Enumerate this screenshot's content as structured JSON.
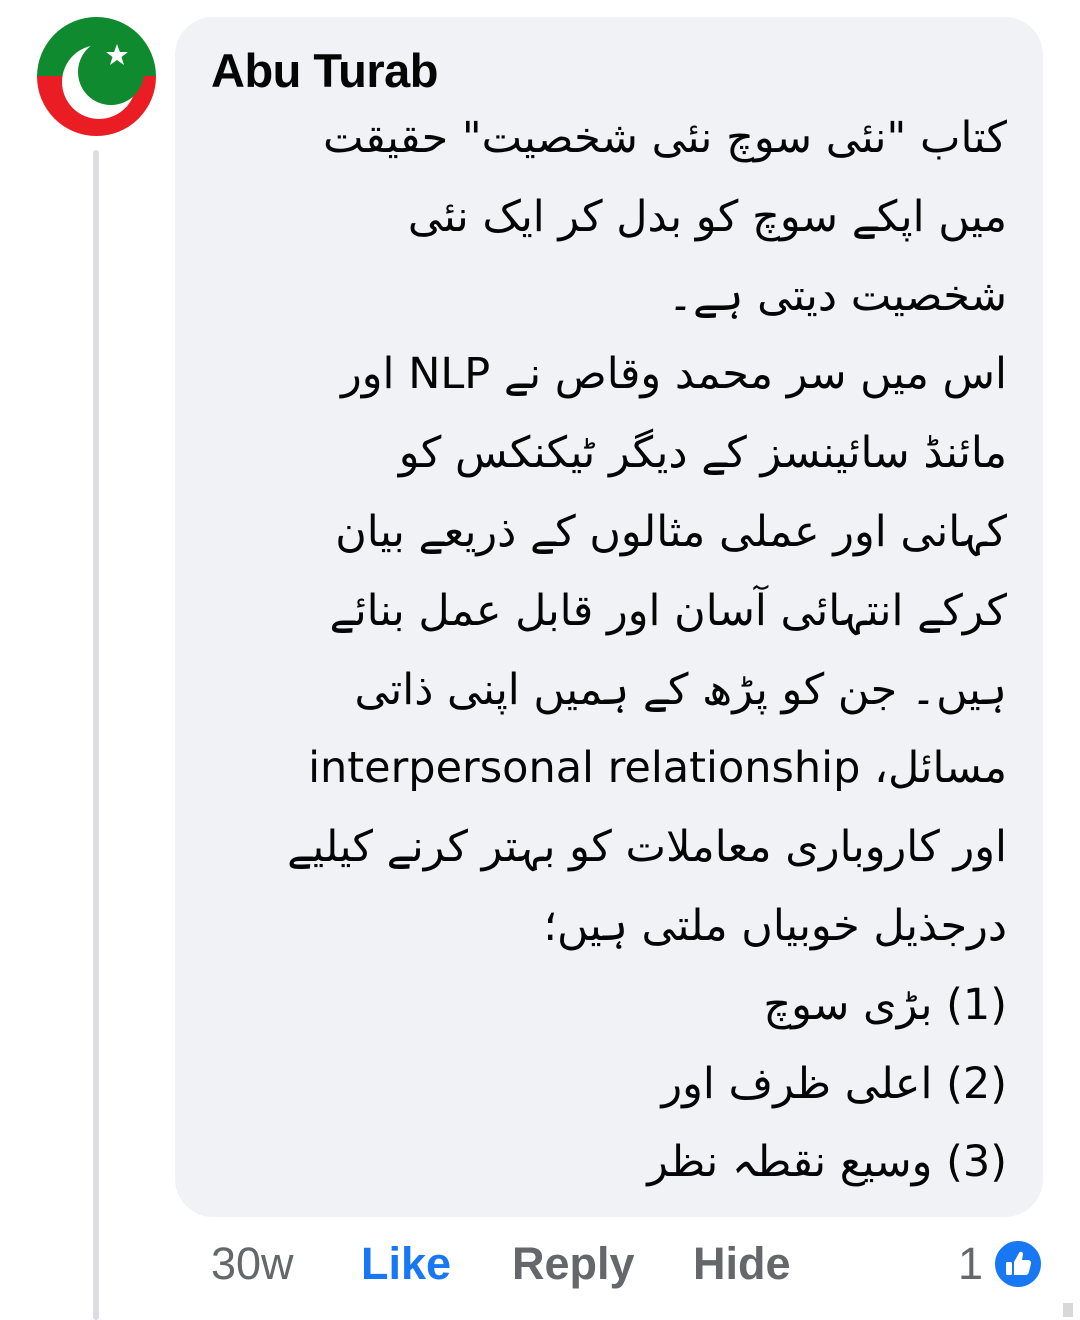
{
  "comment": {
    "author": "Abu Turab",
    "lines": [
      "کتاب \"نئی سوچ نئی شخصیت\"  حقیقت",
      "میں اپکے سوچ کو بدل کر ایک نئی",
      "شخصیت دیتی ہے۔",
      "اس میں سر محمد وقاص نے NLP اور",
      "مائنڈ سائینسز کے دیگر ٹیکنکس کو",
      "کہانی اور عملی مثالوں کے ذریعے بیان",
      "کرکے انتہائی آسان اور قابل عمل بنائے",
      "ہیں۔ جن کو پڑھ کے ہمیں اپنی ذاتی",
      "مسائل، interpersonal relationship",
      "اور کاروباری معاملات کو بہتر کرنے کیلیے",
      "درجذیل خوبیاں ملتی ہیں؛",
      "(1) بڑی سوچ",
      "(2) اعلی ظرف اور",
      "(3) وسیع نقطہ نظر"
    ]
  },
  "actions": {
    "time": "30w",
    "like": "Like",
    "reply": "Reply",
    "hide": "Hide"
  },
  "reactions": {
    "count": "1",
    "icon": "thumbs-up-icon"
  },
  "avatar": {
    "icon": "crescent-star-flag-icon",
    "colors": {
      "top": "#0f8a2e",
      "bottom": "#ea1c24",
      "symbol": "#ffffff"
    }
  },
  "colors": {
    "accent": "#1877f2",
    "muted_text": "#65676b",
    "bubble": "#f0f2f5"
  }
}
